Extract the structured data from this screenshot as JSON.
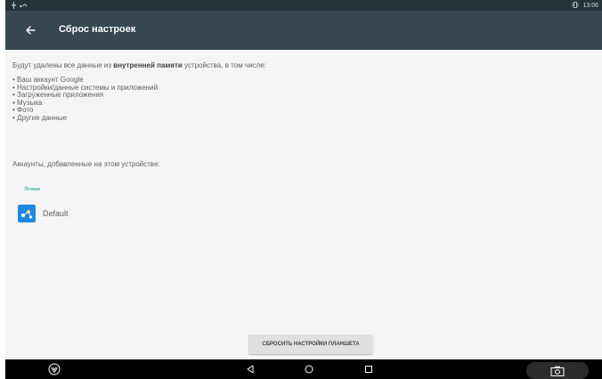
{
  "status_bar": {
    "left_icons": [
      "usb-icon",
      "signal-icon"
    ],
    "right_icons": [
      "vibrate-icon"
    ],
    "time": "13:06"
  },
  "app_bar": {
    "back_icon": "back-arrow-icon",
    "title": "Сброс настроек"
  },
  "content": {
    "intro_prefix": "Будут удалены все данные из ",
    "intro_bold": "внутренней памяти",
    "intro_suffix": " устройства, в том числе:",
    "items": [
      "Ваш аккаунт Google",
      "Настройки/данные системы и приложений",
      "Загруженные приложения",
      "Музыка",
      "Фото",
      "Другие данные"
    ],
    "accounts_label": "Аккаунты, добавленные на этом устройстве:",
    "section_label": "Личные",
    "account": {
      "icon": "account-app-icon",
      "name": "Default"
    },
    "reset_button": "СБРОСИТЬ НАСТРОЙКИ ПЛАНШЕТА"
  },
  "nav_bar": {
    "items": [
      "app-symbol-icon",
      "back-icon",
      "home-icon",
      "recents-icon",
      "screenshot-icon"
    ]
  },
  "colors": {
    "status_bar": "#263238",
    "app_bar": "#37474f",
    "accent": "#009688",
    "background": "#f5f5f5",
    "nav_bar": "#000000"
  }
}
